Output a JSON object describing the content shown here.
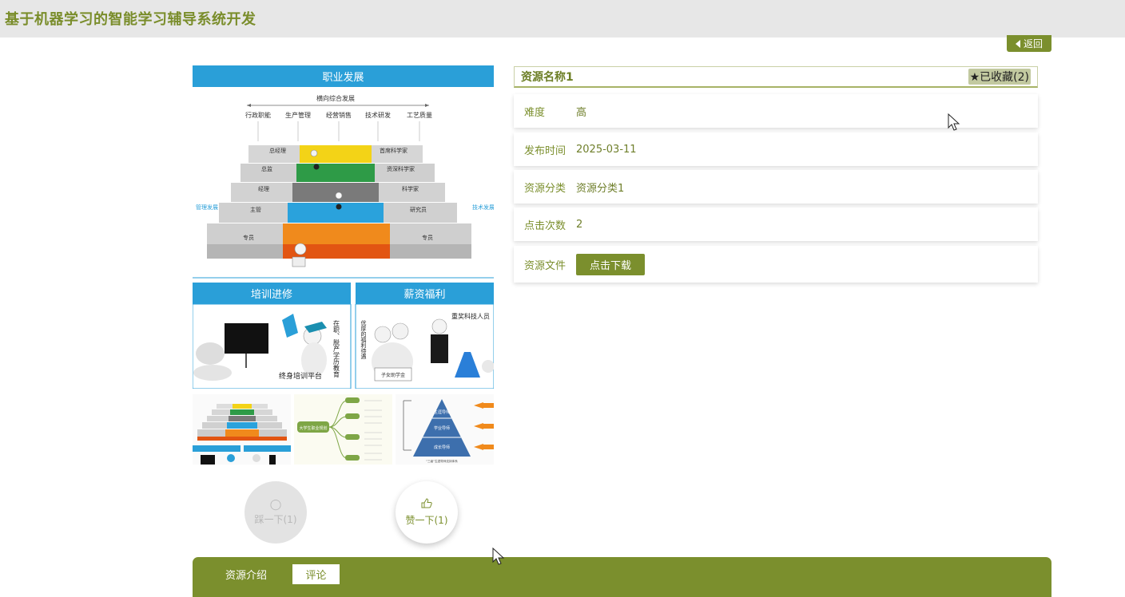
{
  "app": {
    "title": "基于机器学习的智能学习辅导系统开发"
  },
  "nav": {
    "back_label": "返回"
  },
  "gallery": {
    "main": {
      "top_heading": "职业发展",
      "top_subheading": "横向综合发展",
      "columns": [
        "行政职能",
        "生产管理",
        "经营销售",
        "技术研发",
        "工艺质量"
      ],
      "left_steps": [
        "总经理",
        "总监",
        "经理",
        "主管",
        "专员"
      ],
      "right_steps": [
        "首席科学家",
        "资深科学家",
        "科学家",
        "研究员",
        "专员"
      ],
      "left_side": "管理发展",
      "right_side": "技术发展",
      "bottom_left_heading": "培训进修",
      "bottom_left_caption": "终身培训平台",
      "bottom_left_vertical": "在职、脱产学历教育",
      "bottom_right_heading": "薪资福利",
      "bottom_right_caption": "重奖科技人员",
      "bottom_right_vertical": "优厚的福利待遇",
      "bottom_right_sign": "子女助学金"
    },
    "thumb2_center": "大学生职业规划",
    "thumb3_levels": [
      "生涯导师",
      "学业导师",
      "成长导师"
    ],
    "thumb3_caption": "“三级”生涯导师支持体系"
  },
  "votes": {
    "down_label": "踩一下(1)",
    "up_label": "赞一下(1)"
  },
  "resource": {
    "name": "资源名称1",
    "favorite_label": "已收藏(2)",
    "fields": [
      {
        "label": "难度",
        "value": "高"
      },
      {
        "label": "发布时间",
        "value": "2025-03-11"
      },
      {
        "label": "资源分类",
        "value": "资源分类1"
      },
      {
        "label": "点击次数",
        "value": "2"
      }
    ],
    "file_label": "资源文件",
    "download_label": "点击下载"
  },
  "tabs": [
    {
      "label": "资源介绍"
    },
    {
      "label": "评论"
    }
  ],
  "colors": {
    "accent": "#7b8f2d",
    "header_bg": "#e7e7e7",
    "blue": "#2a9fd8"
  }
}
